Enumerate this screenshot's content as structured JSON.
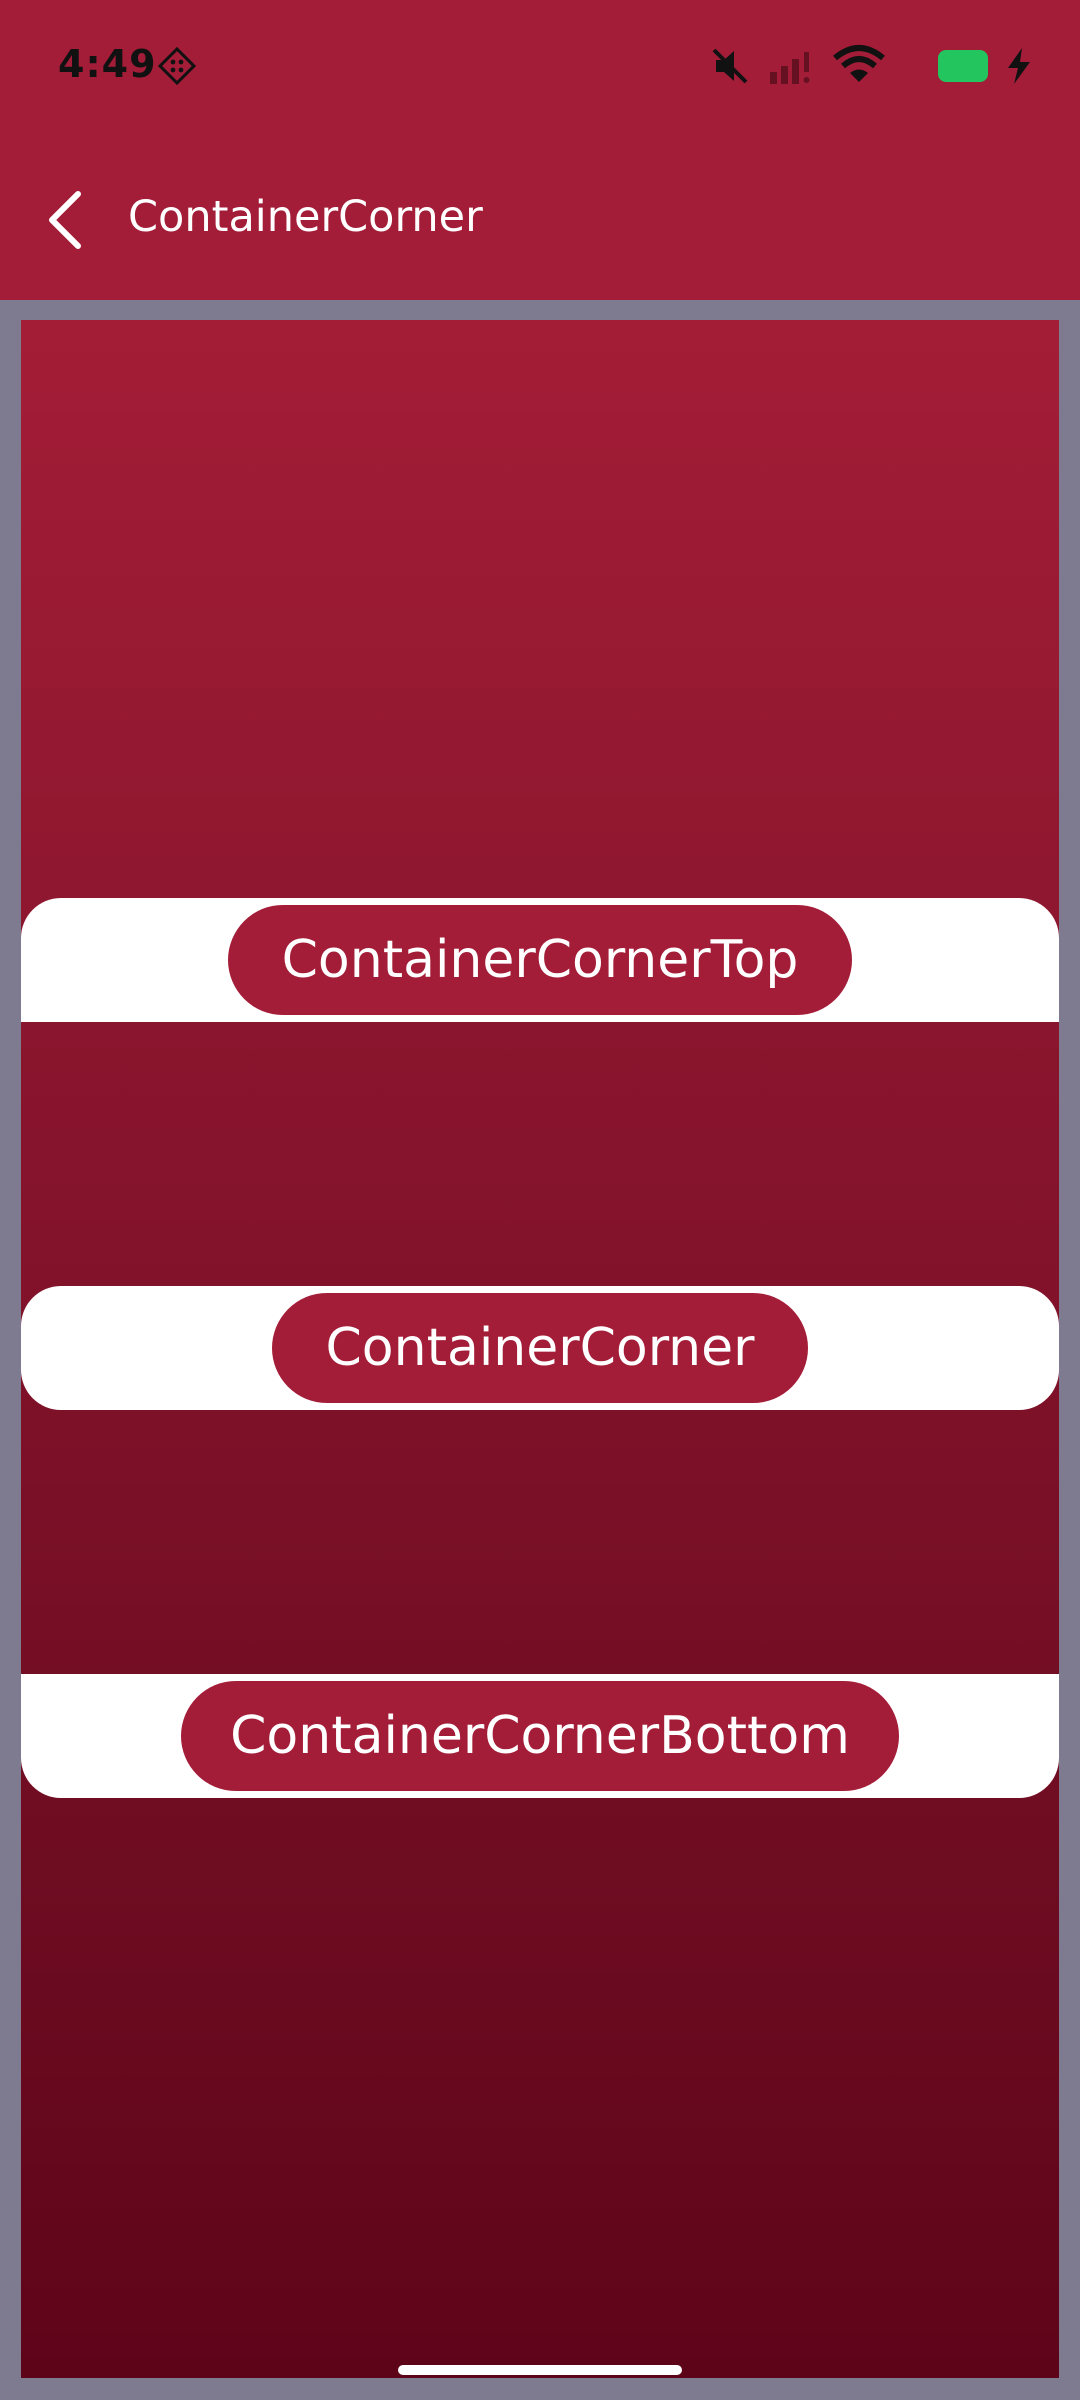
{
  "status_bar": {
    "time": "4:49",
    "icons": [
      "app-notification-icon",
      "mute-icon",
      "signal-icon",
      "wifi-icon",
      "battery-icon",
      "charging-icon"
    ],
    "battery_color": "#22c55e"
  },
  "app_bar": {
    "title": "ContainerCorner",
    "back_icon": "chevron-left-icon"
  },
  "colors": {
    "accent": "#a41d38",
    "frame": "#7e7a8f",
    "strip": "#ffffff"
  },
  "buttons": {
    "top_label": "ContainerCornerTop",
    "all_label": "ContainerCorner",
    "bottom_label": "ContainerCornerBottom"
  }
}
